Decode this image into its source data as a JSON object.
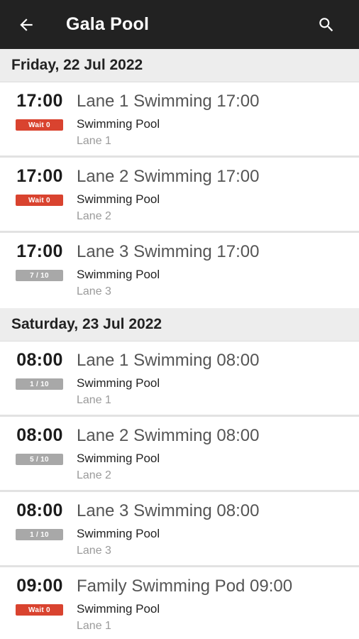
{
  "header": {
    "title": "Gala Pool",
    "back_icon": "arrow-left-icon",
    "search_icon": "search-icon"
  },
  "colors": {
    "appbar": "#222222",
    "wait_badge": "#d9432f",
    "capacity_badge": "#a8a8a8",
    "day_header_bg": "#ededed"
  },
  "days": [
    {
      "label": "Friday, 22 Jul 2022",
      "sessions": [
        {
          "time": "17:00",
          "badge": "Wait 0",
          "badge_type": "wait",
          "name": "Lane 1 Swimming 17:00",
          "venue": "Swimming Pool",
          "lane": "Lane 1"
        },
        {
          "time": "17:00",
          "badge": "Wait 0",
          "badge_type": "wait",
          "name": "Lane 2 Swimming 17:00",
          "venue": "Swimming Pool",
          "lane": "Lane 2"
        },
        {
          "time": "17:00",
          "badge": "7 / 10",
          "badge_type": "cap",
          "name": "Lane 3 Swimming 17:00",
          "venue": "Swimming Pool",
          "lane": "Lane 3"
        }
      ]
    },
    {
      "label": "Saturday, 23 Jul 2022",
      "sessions": [
        {
          "time": "08:00",
          "badge": "1 / 10",
          "badge_type": "cap",
          "name": "Lane 1 Swimming 08:00",
          "venue": "Swimming Pool",
          "lane": "Lane 1"
        },
        {
          "time": "08:00",
          "badge": "5 / 10",
          "badge_type": "cap",
          "name": "Lane 2 Swimming 08:00",
          "venue": "Swimming Pool",
          "lane": "Lane 2"
        },
        {
          "time": "08:00",
          "badge": "1 / 10",
          "badge_type": "cap",
          "name": "Lane 3 Swimming 08:00",
          "venue": "Swimming Pool",
          "lane": "Lane 3"
        },
        {
          "time": "09:00",
          "badge": "Wait 0",
          "badge_type": "wait",
          "name": "Family Swimming Pod 09:00",
          "venue": "Swimming Pool",
          "lane": "Lane 1"
        }
      ]
    }
  ]
}
